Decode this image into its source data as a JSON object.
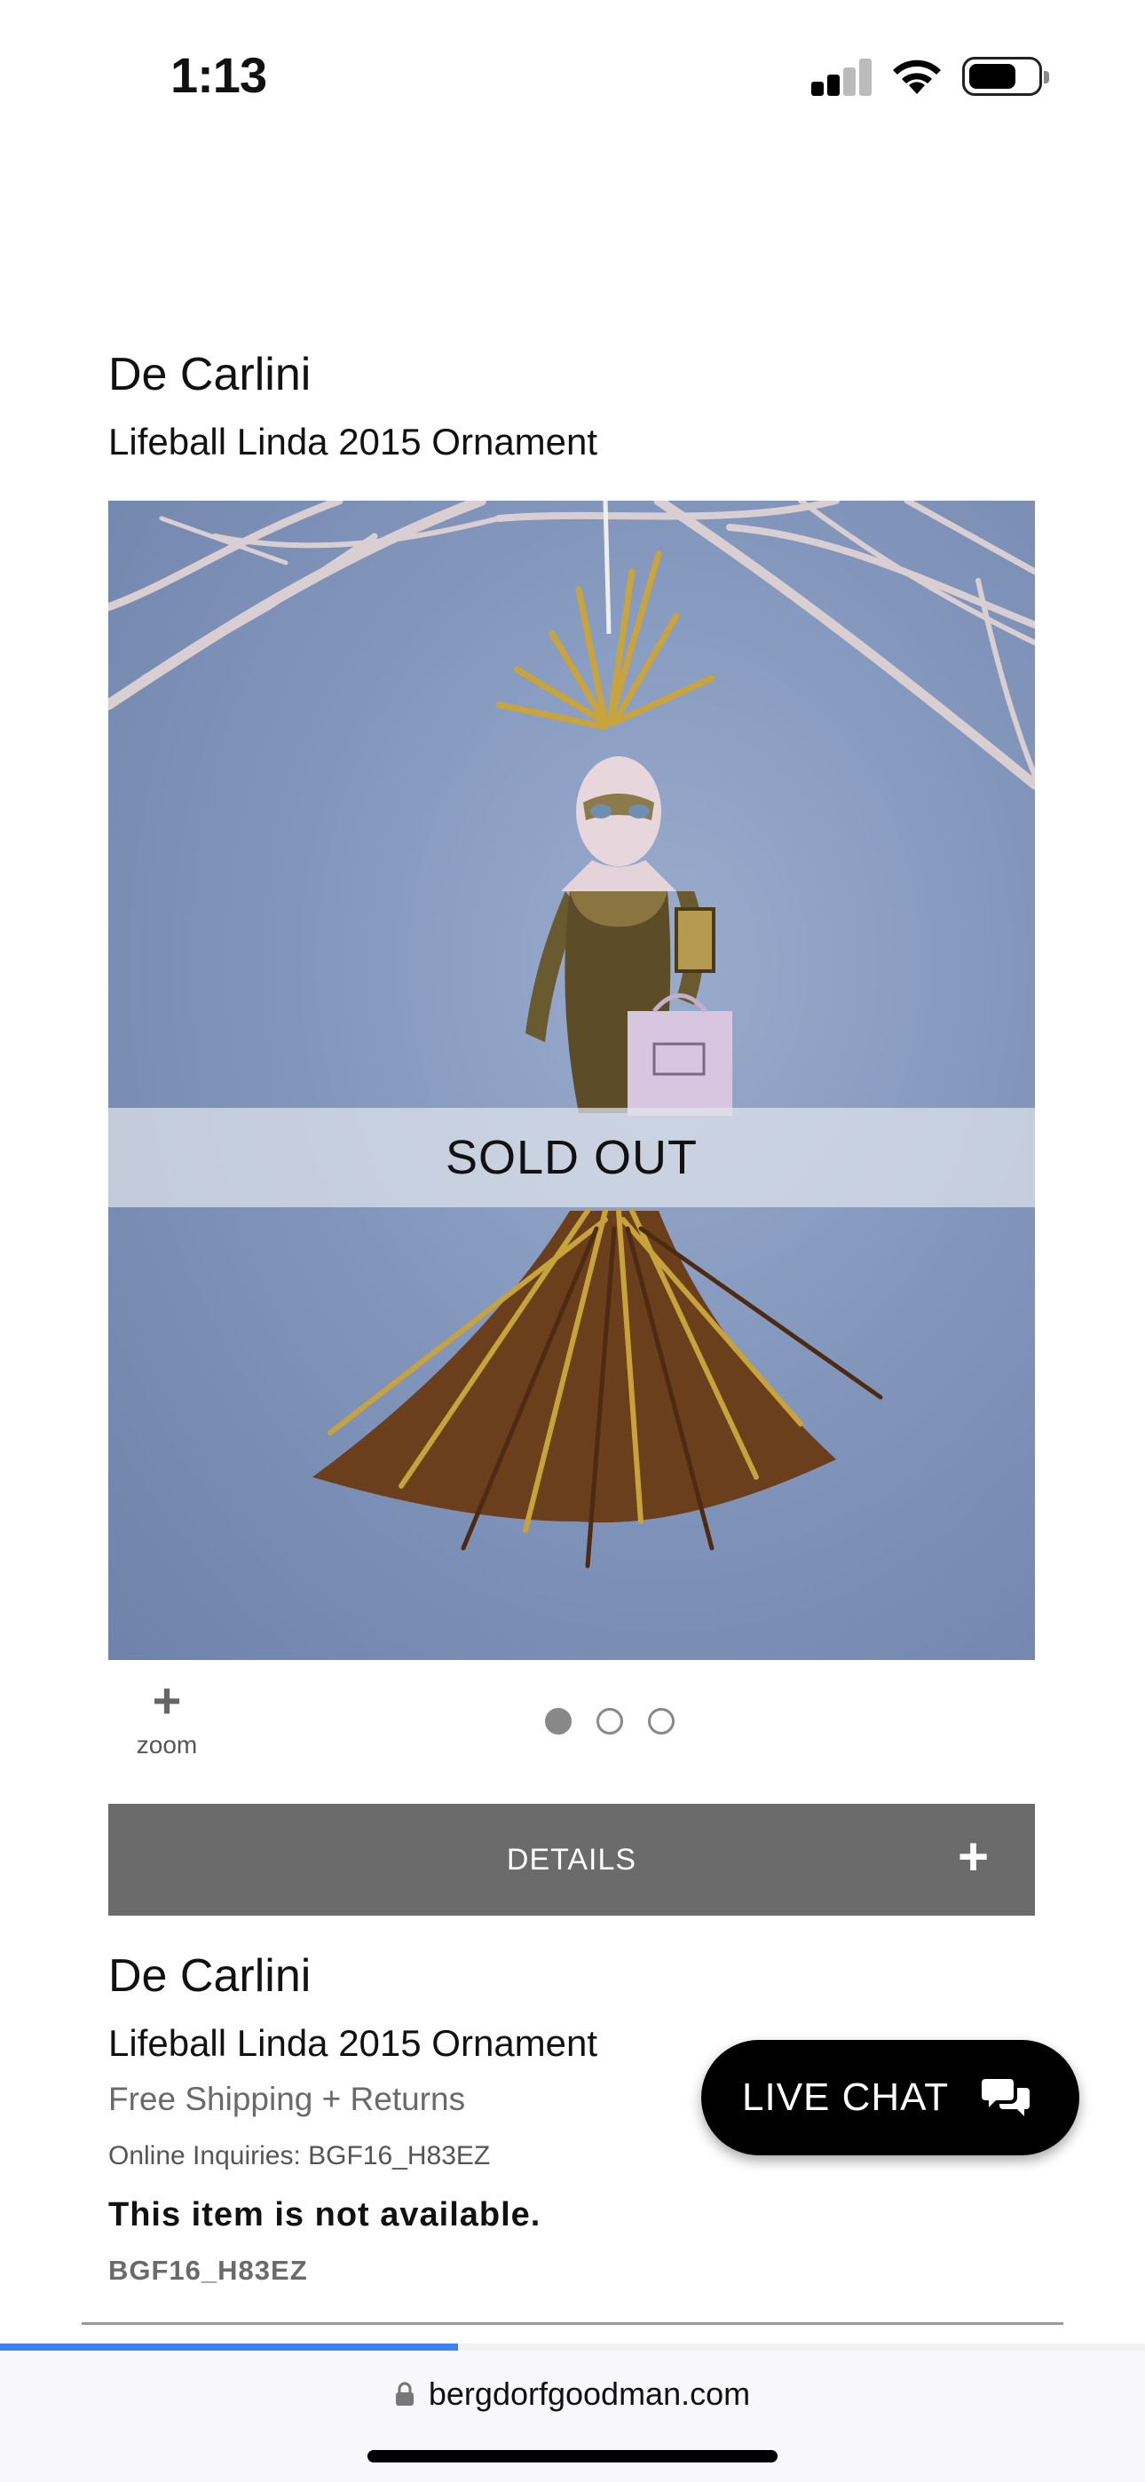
{
  "status_bar": {
    "time": "1:13",
    "signal_bars": 2,
    "battery_level": 0.6
  },
  "product": {
    "brand": "De Carlini",
    "name": "Lifeball Linda 2015 Ornament",
    "image_overlay": "SOLD OUT",
    "image_count": 3,
    "active_image_index": 0,
    "shipping": "Free Shipping + Returns",
    "inquiries": "Online Inquiries: BGF16_H83EZ",
    "availability": "This item is not available.",
    "sku": "BGF16_H83EZ"
  },
  "gallery": {
    "zoom_label": "zoom",
    "zoom_icon": "plus-icon"
  },
  "details": {
    "label": "DETAILS",
    "icon": "plus-icon"
  },
  "live_chat": {
    "label": "LIVE CHAT",
    "icon": "chat-bubbles-icon"
  },
  "browser": {
    "url": "bergdorfgoodman.com",
    "load_progress": 0.4,
    "accent_color": "#3b82f6"
  }
}
